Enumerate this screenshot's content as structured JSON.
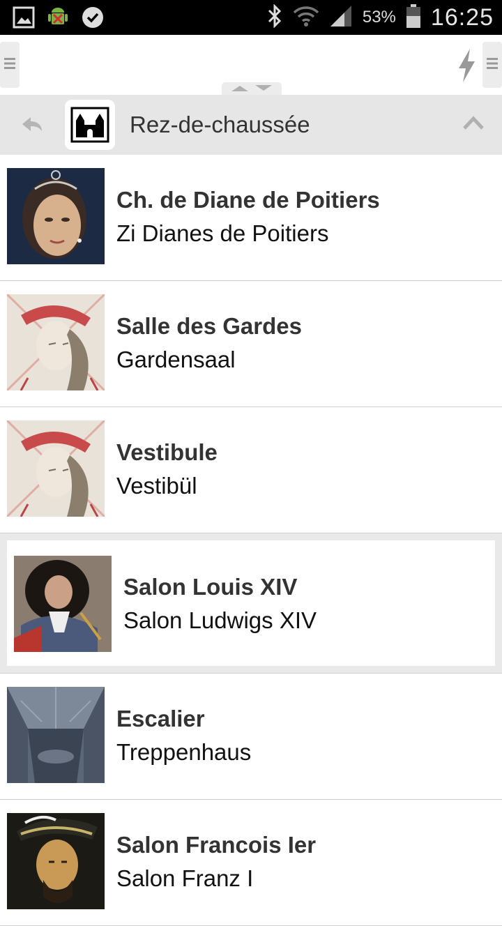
{
  "status_bar": {
    "time": "16:25",
    "battery": "53%",
    "icons": [
      "picture-icon",
      "android-debug-icon",
      "check-badge-icon",
      "bluetooth-icon",
      "wifi-icon",
      "signal-icon",
      "battery-icon"
    ]
  },
  "toolbar": {
    "icons": [
      "menu-handle-icon",
      "flash-icon",
      "menu-handle-icon"
    ]
  },
  "floor": {
    "title": "Rez-de-chaussée"
  },
  "rooms": [
    {
      "name": "Ch. de Diane de Poitiers",
      "translation": "Zi Dianes de Poitiers"
    },
    {
      "name": "Salle des Gardes",
      "translation": "Gardensaal"
    },
    {
      "name": "Vestibule",
      "translation": "Vestibül"
    },
    {
      "name": "Salon Louis XIV",
      "translation": "Salon Ludwigs XIV"
    },
    {
      "name": "Escalier",
      "translation": "Treppenhaus"
    },
    {
      "name": "Salon Francois Ier",
      "translation": "Salon Franz I"
    }
  ],
  "colors": {
    "header_bg": "#e6e6e6",
    "divider": "#cfcfcf",
    "text_primary": "#333333"
  }
}
